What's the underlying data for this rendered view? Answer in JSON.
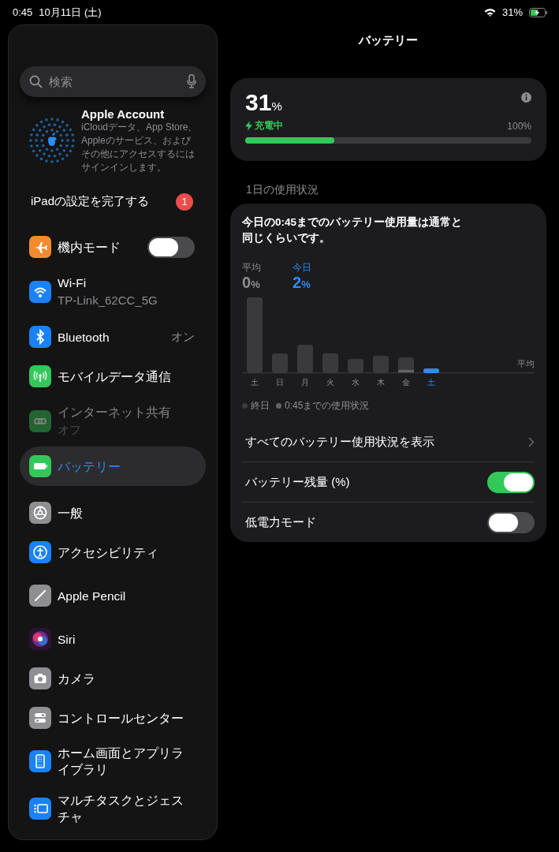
{
  "status_bar": {
    "time": "0:45",
    "date": "10月11日 (土)",
    "battery": "31%"
  },
  "sidebar": {
    "search": {
      "placeholder": "検索"
    },
    "account": {
      "title": "Apple Account",
      "description": "iCloudデータ、App Store、Appleのサービス、およびその他にアクセスするにはサインインします。"
    },
    "setup": {
      "label": "iPadの設定を完了する",
      "badge": "1"
    },
    "groups": [
      [
        {
          "kind": "toggle",
          "label": "機内モード",
          "on": false,
          "selected": false,
          "disabled": false
        },
        {
          "kind": "subtitle",
          "label": "Wi-Fi",
          "subtitle": "TP-Link_62CC_5G",
          "selected": false,
          "disabled": false
        },
        {
          "kind": "value",
          "label": "Bluetooth",
          "value": "オン",
          "selected": false,
          "disabled": false
        },
        {
          "kind": "plain",
          "label": "モバイルデータ通信",
          "selected": false,
          "disabled": false
        },
        {
          "kind": "subtitle",
          "label": "インターネット共有",
          "subtitle": "オフ",
          "selected": false,
          "disabled": true
        },
        {
          "kind": "plain",
          "label": "バッテリー",
          "selected": true,
          "disabled": false
        }
      ],
      [
        {
          "kind": "plain",
          "label": "一般",
          "selected": false,
          "disabled": false
        },
        {
          "kind": "plain",
          "label": "アクセシビリティ",
          "selected": false,
          "disabled": false
        },
        {
          "kind": "plain",
          "label": "Apple Pencil",
          "selected": false,
          "disabled": false
        },
        {
          "kind": "plain",
          "label": "Siri",
          "selected": false,
          "disabled": false
        },
        {
          "kind": "plain",
          "label": "カメラ",
          "selected": false,
          "disabled": false
        },
        {
          "kind": "plain",
          "label": "コントロールセンター",
          "selected": false,
          "disabled": false
        },
        {
          "kind": "plain",
          "label": "ホーム画面とアプリライブラリ",
          "selected": false,
          "disabled": false
        },
        {
          "kind": "plain",
          "label": "マルチタスクとジェスチャ",
          "selected": false,
          "disabled": false
        }
      ]
    ]
  },
  "main": {
    "title": "バッテリー",
    "level_card": {
      "percent": "31",
      "unit": "%",
      "status": "充電中",
      "max": "100%",
      "level": 0.31
    },
    "section_header": "1日の使用状況",
    "usage": {
      "summary": "今日の0:45までのバッテリー使用量は通常と同じくらいです。",
      "stats": [
        {
          "label": "平均",
          "value": "0",
          "unit": "%",
          "selected": false
        },
        {
          "label": "今日",
          "value": "2",
          "unit": "%",
          "selected": true
        }
      ],
      "average_label": "平均",
      "days": [
        {
          "label": "土",
          "selected": false
        },
        {
          "label": "日",
          "selected": false
        },
        {
          "label": "月",
          "selected": false
        },
        {
          "label": "火",
          "selected": false
        },
        {
          "label": "水",
          "selected": false
        },
        {
          "label": "木",
          "selected": false
        },
        {
          "label": "金",
          "selected": false
        },
        {
          "label": "土",
          "selected": true
        }
      ],
      "legend": [
        "終日",
        "0:45までの使用状況"
      ]
    },
    "rows": [
      {
        "kind": "link",
        "label": "すべてのバッテリー使用状況を表示"
      },
      {
        "kind": "toggle",
        "label": "バッテリー残量 (%)",
        "on": true
      },
      {
        "kind": "toggle",
        "label": "低電力モード",
        "on": false
      }
    ]
  }
}
